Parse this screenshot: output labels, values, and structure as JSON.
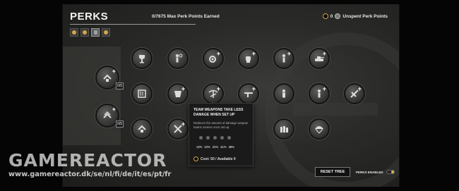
{
  "header": {
    "title": "PERKS",
    "earned_text": "0/7675 Max Perk Points Earned",
    "coin_count": "0",
    "unspent_label": "Unspent Perk Points"
  },
  "filters": [
    {
      "name": "filter-all"
    },
    {
      "name": "filter-offense"
    },
    {
      "name": "filter-defense"
    },
    {
      "name": "filter-support"
    }
  ],
  "column_nodes": [
    {
      "count": "0/5"
    },
    {
      "count": "0/5"
    }
  ],
  "tooltip": {
    "title": "TEAM WEAPONS TAKE LESS DAMAGE WHEN SET UP",
    "description": "Reduces the amount of damage weapon teams receive once set up.",
    "values": [
      "12%",
      "22%",
      "31%",
      "41%",
      "48%"
    ],
    "cost": "Cost: 50 / Available 0"
  },
  "footer": {
    "reset_label": "RESET TREE",
    "perks_enabled_label": "PERKS ENABLED"
  },
  "watermark": {
    "brand": "GAMEREACTOR",
    "url": "www.gamereactor.dk/se/nl/fi/de/it/es/pt/fr"
  },
  "colors": {
    "accent_gold": "#d8a53a",
    "panel": "#2c2c2b"
  }
}
